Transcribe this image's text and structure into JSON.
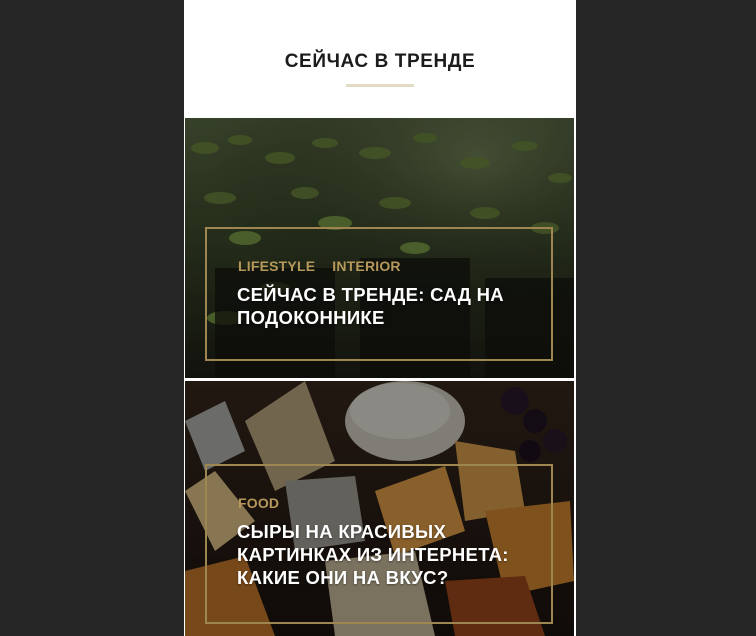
{
  "section": {
    "title": "СЕЙЧАС В ТРЕНДЕ"
  },
  "colors": {
    "accent_gold": "#b6985a",
    "frame_gold": "#9e8650",
    "underline": "#e4dcc2",
    "background": "#262626"
  },
  "cards": [
    {
      "image": "seedlings-photo",
      "tags": [
        "LIFESTYLE",
        "INTERIOR"
      ],
      "title": "СЕЙЧАС В ТРЕНДЕ: САД НА ПОДОКОННИКЕ"
    },
    {
      "image": "cheese-platter-photo",
      "tags": [
        "FOOD"
      ],
      "title": "СЫРЫ НА КРАСИВЫХ КАРТИНКАХ ИЗ ИНТЕРНЕТА: КАКИЕ ОНИ НА ВКУС?"
    }
  ]
}
